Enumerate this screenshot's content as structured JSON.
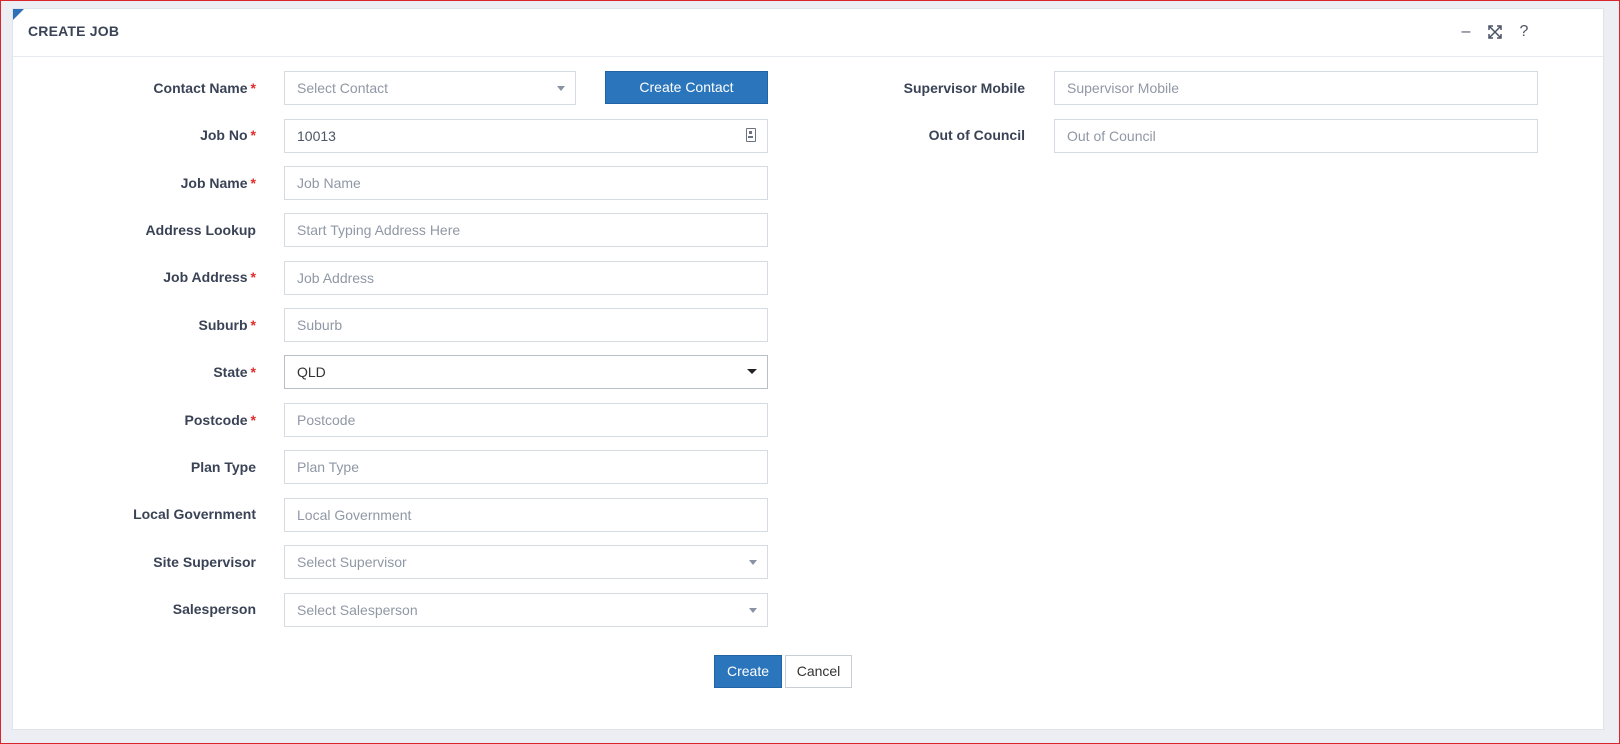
{
  "dialog": {
    "title": "CREATE JOB",
    "controls": {
      "minimize": "–",
      "help": "?"
    }
  },
  "form": {
    "contact_name": {
      "label": "Contact Name",
      "required": "*",
      "placeholder": "Select Contact"
    },
    "create_contact_button": "Create Contact",
    "job_no": {
      "label": "Job No",
      "required": "*",
      "value": "10013"
    },
    "job_name": {
      "label": "Job Name",
      "required": "*",
      "placeholder": "Job Name"
    },
    "address_lookup": {
      "label": "Address Lookup",
      "placeholder": "Start Typing Address Here"
    },
    "job_address": {
      "label": "Job Address",
      "required": "*",
      "placeholder": "Job Address"
    },
    "suburb": {
      "label": "Suburb",
      "required": "*",
      "placeholder": "Suburb"
    },
    "state": {
      "label": "State",
      "required": "*",
      "value": "QLD"
    },
    "postcode": {
      "label": "Postcode",
      "required": "*",
      "placeholder": "Postcode"
    },
    "plan_type": {
      "label": "Plan Type",
      "placeholder": "Plan Type"
    },
    "local_government": {
      "label": "Local Government",
      "placeholder": "Local Government"
    },
    "site_supervisor": {
      "label": "Site Supervisor",
      "placeholder": "Select Supervisor"
    },
    "salesperson": {
      "label": "Salesperson",
      "placeholder": "Select Salesperson"
    },
    "supervisor_mobile": {
      "label": "Supervisor Mobile",
      "placeholder": "Supervisor Mobile"
    },
    "out_of_council": {
      "label": "Out of Council",
      "placeholder": "Out of Council"
    }
  },
  "actions": {
    "create": "Create",
    "cancel": "Cancel"
  },
  "colors": {
    "primary": "#2a75bb",
    "required": "#e02b2b",
    "window_border": "#d9262c"
  }
}
